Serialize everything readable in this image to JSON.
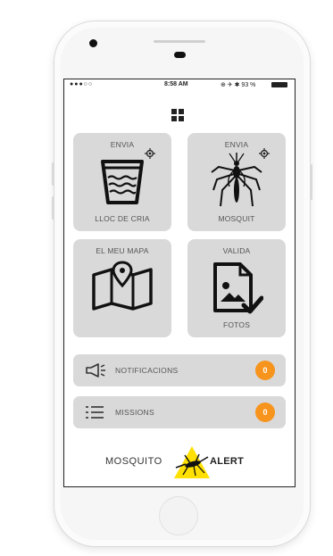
{
  "statusbar": {
    "signal": "●●●○○",
    "time": "8:58 AM",
    "icons": "⊕ ✈ ✱ 93 %"
  },
  "tiles": [
    {
      "top_label": "ENVIA",
      "bottom_label": "LLOC DE CRIA",
      "icon": "bucket-icon"
    },
    {
      "top_label": "ENVIA",
      "bottom_label": "MOSQUIT",
      "icon": "mosquito-icon"
    },
    {
      "top_label": "EL MEU MAPA",
      "bottom_label": "",
      "icon": "map-pin-icon"
    },
    {
      "top_label": "VALIDA",
      "bottom_label": "FOTOS",
      "icon": "photo-check-icon"
    }
  ],
  "bars": [
    {
      "label": "NOTIFICACIONS",
      "count": "0",
      "icon": "megaphone-icon"
    },
    {
      "label": "MISSIONS",
      "count": "0",
      "icon": "checklist-icon"
    }
  ],
  "footer": {
    "left": "MOSQUITO",
    "right": "ALERT"
  },
  "colors": {
    "tile": "#d9d9d9",
    "badge": "#f7941d",
    "logo_yellow": "#ffe000"
  }
}
